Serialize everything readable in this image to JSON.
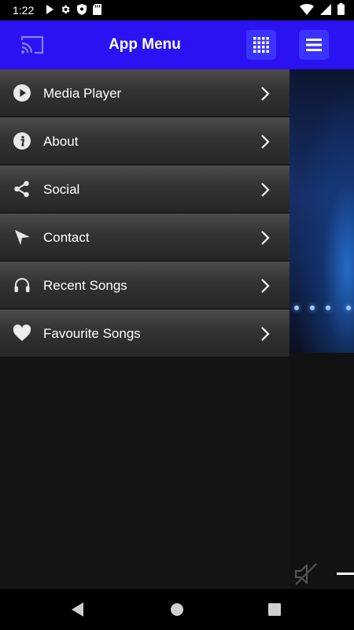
{
  "status_bar": {
    "time": "1:22",
    "left_icons": [
      "play-icon",
      "gear-icon",
      "shield-icon",
      "sd-card-icon"
    ],
    "right_icons": [
      "wifi-icon",
      "signal-icon",
      "battery-icon"
    ]
  },
  "drawer": {
    "title": "App Menu",
    "header_color": "#2a12f2",
    "button_color": "#3b33ff",
    "items": [
      {
        "label": "Media Player",
        "icon": "play-circle-icon"
      },
      {
        "label": "About",
        "icon": "info-icon"
      },
      {
        "label": "Social",
        "icon": "share-icon"
      },
      {
        "label": "Contact",
        "icon": "send-icon"
      },
      {
        "label": "Recent Songs",
        "icon": "headphones-icon"
      },
      {
        "label": "Favourite Songs",
        "icon": "heart-icon"
      }
    ]
  },
  "background_app": {
    "menu_icon": "hamburger-icon",
    "mute_icon": "volume-off-icon"
  },
  "nav_bar": {
    "icons": [
      "back-icon",
      "home-icon",
      "recents-icon"
    ]
  }
}
